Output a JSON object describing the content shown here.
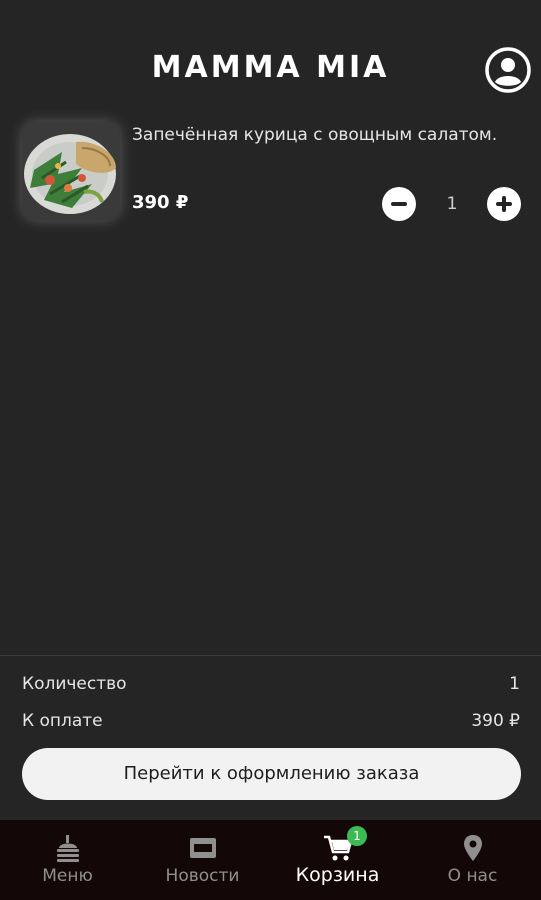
{
  "header": {
    "title": "MAMMA MIA",
    "profile_icon": "account-circle-icon"
  },
  "cart": {
    "items": [
      {
        "name": "Запечённая курица с овощным салатом.",
        "price": "390 ₽",
        "quantity": "1",
        "image": "chicken-salad-photo"
      }
    ]
  },
  "summary": {
    "quantity_label": "Количество",
    "quantity_value": "1",
    "total_label": "К оплате",
    "total_value": "390 ₽"
  },
  "checkout_button": "Перейти к оформлению заказа",
  "nav": {
    "items": [
      {
        "label": "Меню",
        "icon": "menu-food-icon"
      },
      {
        "label": "Новости",
        "icon": "news-icon"
      },
      {
        "label": "Корзина",
        "icon": "cart-icon",
        "active": true
      },
      {
        "label": "О нас",
        "icon": "location-pin-icon"
      }
    ],
    "cart_badge": "1"
  },
  "colors": {
    "background": "#262526",
    "nav_background": "#140708",
    "badge": "#3cba54",
    "button": "#f2f2f2"
  }
}
